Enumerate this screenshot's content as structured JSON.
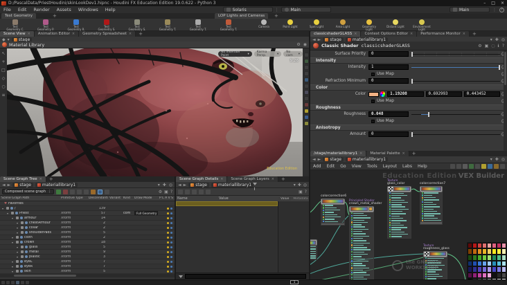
{
  "window": {
    "title": "D:/PascalData/PriestHoudini/skinLookDev1.hipnc - Houdini FX Education Edition 19.0.622 - Python 3",
    "minimize": "–",
    "maximize": "□",
    "close": "×"
  },
  "menubar": {
    "items": [
      "File",
      "Edit",
      "Render",
      "Assets",
      "Windows",
      "Help"
    ],
    "desktop_selector": "Solaris",
    "desktop_selector2": "Main",
    "right_selector": "Main",
    "help": "?"
  },
  "shelf": {
    "left_tab": "Test Geometry",
    "right_tab": "LOP Lights and Cameras",
    "tools": [
      "Test\nGeometry C.",
      "Test\nGeometry P.",
      "Test\nGeometry R.",
      "Test\nGeometry S.",
      "Test\nGeometry S.",
      "Test\nGeometry T.",
      "Test\nGeometry T.",
      "Test\nGeometry T."
    ],
    "light_tools": [
      "Camera",
      "Point Light",
      "Spot Light",
      "Area Light",
      "Geometry\nLight",
      "Distant Light",
      "Environment\nLight"
    ]
  },
  "left_pane": {
    "tabs": [
      "Scene View",
      "Animation Editor",
      "Geometry Spreadsheet"
    ],
    "path": [
      "stage"
    ],
    "panel_title": "Material Library",
    "viewport": {
      "pills": [
        "No Insertion Point",
        "Karma Persp.",
        "No cam"
      ],
      "time": "9:26",
      "watermark": "Education Edition"
    }
  },
  "right_pane": {
    "tabs": [
      "classicshaderGLASS",
      "Context Options Editor",
      "Performance Monitor"
    ],
    "path": [
      "stage",
      "materiallibrary1"
    ],
    "params": {
      "header_label": "Classic Shader",
      "node_name": "classicshaderGLASS",
      "surface_priority": {
        "label": "Surface Priority",
        "value": "0"
      },
      "section_intensity": "Intensity",
      "intensity": {
        "label": "Intensity",
        "value": "1"
      },
      "use_map": "Use Map",
      "refraction_minimum": {
        "label": "Refraction Minimum",
        "value": "0"
      },
      "section_color": "Color",
      "color": {
        "label": "Color",
        "r": "1.19208",
        "g": "0.692993",
        "b": "0.443452",
        "swatch": "#f2b284"
      },
      "section_roughness": "Roughness",
      "roughness": {
        "label": "Roughness",
        "value": "0.048"
      },
      "section_anisotropy": "Anisotropy",
      "amount": {
        "label": "Amount",
        "value": "0"
      }
    },
    "net_tabs": [
      "/stage/materiallibrary1",
      "Material Palette"
    ],
    "net_path": [
      "stage",
      "materiallibrary1"
    ],
    "net_menu": [
      "Add",
      "Edit",
      "Go",
      "View",
      "Tools",
      "Layout",
      "Labs",
      "Help"
    ],
    "network": {
      "watermark": "Education Edition",
      "builder_label": "VEX Builder",
      "gnomon_watermark": "the GNOMON\nWORKSHOP",
      "nodes": [
        {
          "title": "colorcorrection6",
          "subtitle": "",
          "rows": 8,
          "footer": true
        },
        {
          "title": "crown_metal_shader",
          "subtitle": "Principled Shader",
          "rows": 30,
          "first_row": "surface"
        },
        {
          "title": "glass_color",
          "subtitle": "Texture",
          "rows": 20
        },
        {
          "title": "colorcorrection7",
          "subtitle": "",
          "rows": 13,
          "footer": true
        },
        {
          "title": "roughness_glass",
          "subtitle": "Texture",
          "rows": 12
        }
      ],
      "palette": [
        [
          "#600808",
          "#b81818",
          "#d04040",
          "#e07070",
          "#eda0a0",
          "#e06080",
          "#c03060",
          "#e890a8"
        ],
        [
          "#804000",
          "#c06810",
          "#e09020",
          "#eab428",
          "#f0d060",
          "#f8e820",
          "#fff040",
          "#f8f0b0"
        ],
        [
          "#1a4a10",
          "#2e7a1e",
          "#48aa28",
          "#70cc40",
          "#a0e070",
          "#20885a",
          "#50b888",
          "#a8dcc0"
        ],
        [
          "#10306e",
          "#2050b0",
          "#3878d8",
          "#68a4ec",
          "#a0ccf8",
          "#2890b8",
          "#58c0dc",
          "#a8e0ec"
        ],
        [
          "#181858",
          "#303090",
          "#5040b8",
          "#7868d8",
          "#a898ec",
          "#4848c8",
          "#7878e0",
          "#b8b8f0"
        ],
        [
          "#581048",
          "#902078",
          "#c040a0",
          "#e070c0",
          "#f0a8dc",
          "#101010",
          "#282828",
          "#484848"
        ],
        [
          "#000000",
          "#2a2a2a",
          "#505050",
          "#787878",
          "#a0a0a0",
          "#c4c4c4",
          "#e4e4e4",
          "#ffffff"
        ]
      ]
    }
  },
  "tree_panel": {
    "tab": "Scene Graph Tree",
    "path": [
      "stage",
      "materiallibrary1"
    ],
    "mode": "Composed scene graph",
    "columns": [
      "Scene Graph Path",
      "Primitive Type",
      "Descendants",
      "Variant",
      "Kind",
      "Draw Mode",
      "P L A V S"
    ],
    "favorites_label": "Favorites",
    "rows": [
      {
        "name": "/",
        "type": "",
        "desc": "139",
        "kind": "",
        "draw": "",
        "indent": 0,
        "parent": true
      },
      {
        "name": "Priest",
        "type": "Xform",
        "desc": "57",
        "kind": "com",
        "draw": "Full Geometry",
        "indent": 1,
        "parent": true
      },
      {
        "name": "armour",
        "type": "Xform",
        "desc": "14",
        "kind": "",
        "draw": "",
        "indent": 2,
        "parent": true
      },
      {
        "name": "chestArmour",
        "type": "Xform",
        "desc": "2",
        "kind": "",
        "draw": "",
        "indent": 3,
        "parent": true
      },
      {
        "name": "collar",
        "type": "Xform",
        "desc": "2",
        "kind": "",
        "draw": "",
        "indent": 3,
        "parent": true
      },
      {
        "name": "shoulderPads",
        "type": "Xform",
        "desc": "5",
        "kind": "",
        "draw": "",
        "indent": 3,
        "parent": true
      },
      {
        "name": "cloth",
        "type": "Xform",
        "desc": "2",
        "kind": "",
        "draw": "",
        "indent": 2,
        "parent": true
      },
      {
        "name": "crown",
        "type": "Xform",
        "desc": "18",
        "kind": "",
        "draw": "",
        "indent": 2,
        "parent": true
      },
      {
        "name": "glass",
        "type": "Xform",
        "desc": "5",
        "kind": "",
        "draw": "",
        "indent": 3,
        "parent": true
      },
      {
        "name": "metal",
        "type": "Xform",
        "desc": "9",
        "kind": "",
        "draw": "",
        "indent": 3,
        "parent": true
      },
      {
        "name": "plastic",
        "type": "Xform",
        "desc": "3",
        "kind": "",
        "draw": "",
        "indent": 3,
        "parent": true
      },
      {
        "name": "eyeL",
        "type": "Xform",
        "desc": "7",
        "kind": "",
        "draw": "",
        "indent": 2,
        "parent": true
      },
      {
        "name": "eyeR",
        "type": "Xform",
        "desc": "7",
        "kind": "",
        "draw": "",
        "indent": 2,
        "parent": true
      },
      {
        "name": "skin",
        "type": "Xform",
        "desc": "5",
        "kind": "",
        "draw": "",
        "indent": 2,
        "parent": true
      }
    ]
  },
  "details_panel": {
    "tabs": [
      "Scene Graph Details",
      "Scene Graph Layers"
    ],
    "path": [
      "stage",
      "materiallibrary1"
    ],
    "columns": [
      "Name",
      "Value"
    ],
    "side_tabs": [
      "Value",
      "Metadata"
    ]
  },
  "playbar": {
    "frame": "1"
  },
  "colors": {
    "accent_orange": "#d6883a",
    "slider_fill": "#4a7ab5",
    "wire_green": "#63c98b",
    "wire_teal": "#4fa89a",
    "highlight_row": "#6b5e1f"
  }
}
